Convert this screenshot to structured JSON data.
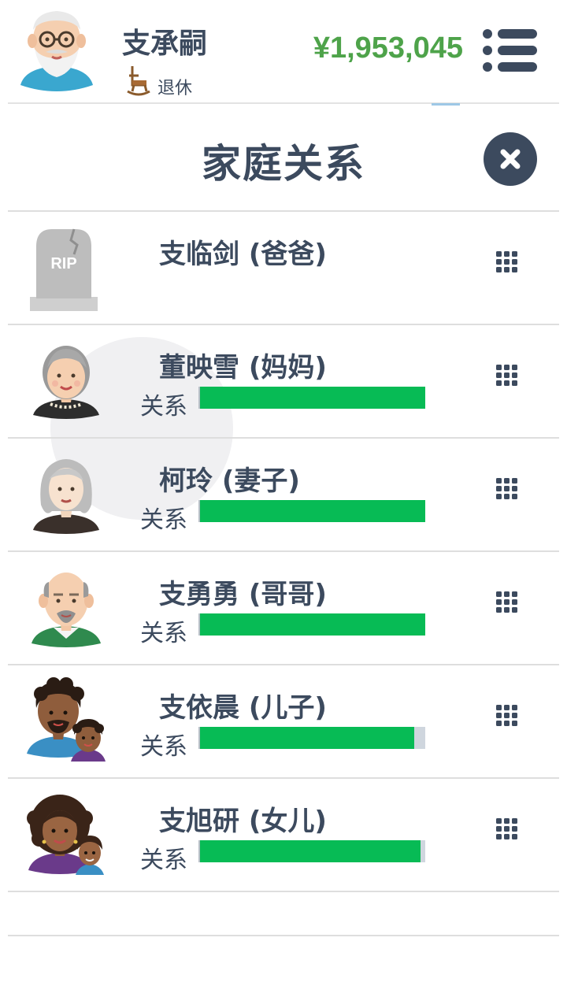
{
  "player": {
    "name": "支承嗣",
    "status": "退休",
    "money": "¥1,953,045"
  },
  "panel": {
    "title": "家庭关系"
  },
  "relationship_label": "关系",
  "family": [
    {
      "name": "支临剑 (爸爸)",
      "deceased": true,
      "relationship": null,
      "portrait": "rip-tombstone"
    },
    {
      "name": "董映雪 (妈妈)",
      "deceased": false,
      "relationship": 1.0,
      "portrait": "elderly-woman-avatar"
    },
    {
      "name": "柯玲 (妻子)",
      "deceased": false,
      "relationship": 1.0,
      "portrait": "elderly-woman-gray-hair-avatar"
    },
    {
      "name": "支勇勇 (哥哥)",
      "deceased": false,
      "relationship": 1.0,
      "portrait": "elderly-man-avatar"
    },
    {
      "name": "支依晨 (儿子)",
      "deceased": false,
      "relationship": 0.95,
      "portrait": "man-with-child-avatar"
    },
    {
      "name": "支旭研 (女儿)",
      "deceased": false,
      "relationship": 0.98,
      "portrait": "woman-with-child-avatar"
    }
  ],
  "colors": {
    "text": "#3c4a5e",
    "money": "#4ea34a",
    "relationship_fill": "#07bb55",
    "relationship_track": "#cfd6de"
  }
}
